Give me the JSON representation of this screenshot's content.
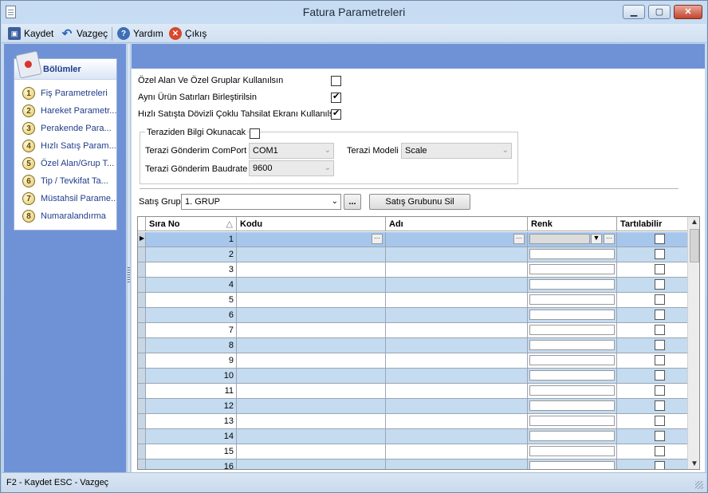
{
  "window": {
    "title": "Fatura Parametreleri",
    "minimize": "▁",
    "maximize": "▢",
    "close": "✕"
  },
  "toolbar": {
    "save": "Kaydet",
    "cancel": "Vazgeç",
    "help": "Yardım",
    "exit": "Çıkış"
  },
  "sections": {
    "title": "Bölümler",
    "items": [
      {
        "n": "1",
        "label": "Fiş Parametreleri"
      },
      {
        "n": "2",
        "label": "Hareket Parametr..."
      },
      {
        "n": "3",
        "label": "Perakende Para..."
      },
      {
        "n": "4",
        "label": "Hızlı Satış Param..."
      },
      {
        "n": "5",
        "label": "Özel Alan/Grup T..."
      },
      {
        "n": "6",
        "label": "Tip / Tevkifat Ta..."
      },
      {
        "n": "7",
        "label": "Müstahsil Parame..."
      },
      {
        "n": "8",
        "label": "Numaralandırma"
      }
    ]
  },
  "options": {
    "ozel_alan": {
      "label": "Özel Alan Ve Özel Gruplar Kullanılsın",
      "checked": false
    },
    "ayni_urun": {
      "label": "Aynı Ürün Satırları Birleştirilsin",
      "checked": true
    },
    "hizli_satis": {
      "label": "Hızlı Satışta Dövizli Çoklu Tahsilat Ekranı Kullanılsın",
      "checked": true
    }
  },
  "scale": {
    "read_label": "Teraziden Bilgi Okunacak",
    "read_checked": false,
    "comport_label": "Terazi Gönderim ComPort",
    "comport_value": "COM1",
    "model_label": "Terazi Modeli",
    "model_value": "Scale",
    "baud_label": "Terazi Gönderim Baudrate",
    "baud_value": "9600"
  },
  "sales_group": {
    "label": "Satış Grup",
    "value": "1. GRUP",
    "ellipsis": "...",
    "delete_button": "Satış Grubunu Sil"
  },
  "grid": {
    "columns": {
      "sira": "Sıra No",
      "kodu": "Kodu",
      "adi": "Adı",
      "renk": "Renk",
      "tartilabilir": "Tartılabilir"
    },
    "sort_icon": "△",
    "rows": [
      "1",
      "2",
      "3",
      "4",
      "5",
      "6",
      "7",
      "8",
      "9",
      "10",
      "11",
      "12",
      "13",
      "14",
      "15",
      "16"
    ]
  },
  "status": {
    "text": "F2 - Kaydet  ESC - Vazgeç"
  }
}
